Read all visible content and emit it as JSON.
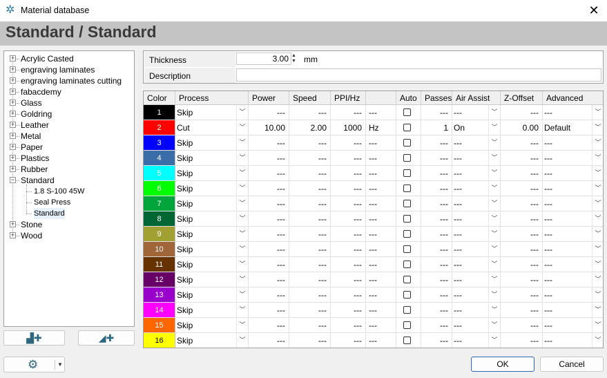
{
  "window": {
    "title": "Material database",
    "icon": "laser-tool-icon",
    "close_icon": "close-icon"
  },
  "heading": "Standard / Standard",
  "tree": {
    "items": [
      {
        "label": "Acrylic Casted",
        "expander": "+"
      },
      {
        "label": "engraving laminates",
        "expander": "+"
      },
      {
        "label": "engraving laminates cutting",
        "expander": "+"
      },
      {
        "label": "fabacdemy",
        "expander": "+"
      },
      {
        "label": "Glass",
        "expander": "+"
      },
      {
        "label": "Goldring",
        "expander": "+"
      },
      {
        "label": "Leather",
        "expander": "+"
      },
      {
        "label": "Metal",
        "expander": "+"
      },
      {
        "label": "Paper",
        "expander": "+"
      },
      {
        "label": "Plastics",
        "expander": "+"
      },
      {
        "label": "Rubber",
        "expander": "+"
      },
      {
        "label": "Standard",
        "expander": "−"
      },
      {
        "label": "1.8 S-100 45W",
        "child": true
      },
      {
        "label": "Seal Press",
        "child": true
      },
      {
        "label": "Standard",
        "child": true,
        "selected": true
      },
      {
        "label": "Stone",
        "expander": "+"
      },
      {
        "label": "Wood",
        "expander": "+"
      }
    ],
    "add_material_icon": "add-material-icon",
    "add_setting_icon": "add-setting-icon"
  },
  "properties": {
    "thickness_label": "Thickness",
    "thickness_value": "3.00",
    "thickness_unit": "mm",
    "description_label": "Description",
    "description_value": ""
  },
  "grid": {
    "headers": [
      "Color",
      "Process",
      "Power",
      "Speed",
      "PPI/Hz",
      "",
      "Auto",
      "Passes",
      "Air Assist",
      "Z-Offset",
      "Advanced"
    ],
    "rows": [
      {
        "num": "1",
        "color": "#000000",
        "text": "#ffffff",
        "process": "Skip",
        "power": "---",
        "speed": "---",
        "ppi": "---",
        "unit": "---",
        "passes": "---",
        "air": "---",
        "z": "---",
        "adv": "---"
      },
      {
        "num": "2",
        "color": "#ff0000",
        "text": "#ffffff",
        "process": "Cut",
        "power": "10.00",
        "speed": "2.00",
        "ppi": "1000",
        "unit": "Hz",
        "passes": "1",
        "air": "On",
        "z": "0.00",
        "adv": "Default"
      },
      {
        "num": "3",
        "color": "#0000ff",
        "text": "#ffffff",
        "process": "Skip",
        "power": "---",
        "speed": "---",
        "ppi": "---",
        "unit": "---",
        "passes": "---",
        "air": "---",
        "z": "---",
        "adv": "---"
      },
      {
        "num": "4",
        "color": "#3b6da8",
        "text": "#ffffff",
        "process": "Skip",
        "power": "---",
        "speed": "---",
        "ppi": "---",
        "unit": "---",
        "passes": "---",
        "air": "---",
        "z": "---",
        "adv": "---"
      },
      {
        "num": "5",
        "color": "#00ffff",
        "text": "#ffffff",
        "process": "Skip",
        "power": "---",
        "speed": "---",
        "ppi": "---",
        "unit": "---",
        "passes": "---",
        "air": "---",
        "z": "---",
        "adv": "---"
      },
      {
        "num": "6",
        "color": "#00ff00",
        "text": "#ffffff",
        "process": "Skip",
        "power": "---",
        "speed": "---",
        "ppi": "---",
        "unit": "---",
        "passes": "---",
        "air": "---",
        "z": "---",
        "adv": "---"
      },
      {
        "num": "7",
        "color": "#00a53c",
        "text": "#ffffff",
        "process": "Skip",
        "power": "---",
        "speed": "---",
        "ppi": "---",
        "unit": "---",
        "passes": "---",
        "air": "---",
        "z": "---",
        "adv": "---"
      },
      {
        "num": "8",
        "color": "#006633",
        "text": "#ffffff",
        "process": "Skip",
        "power": "---",
        "speed": "---",
        "ppi": "---",
        "unit": "---",
        "passes": "---",
        "air": "---",
        "z": "---",
        "adv": "---"
      },
      {
        "num": "9",
        "color": "#a0a033",
        "text": "#ffffff",
        "process": "Skip",
        "power": "---",
        "speed": "---",
        "ppi": "---",
        "unit": "---",
        "passes": "---",
        "air": "---",
        "z": "---",
        "adv": "---"
      },
      {
        "num": "10",
        "color": "#a0663a",
        "text": "#ffffff",
        "process": "Skip",
        "power": "---",
        "speed": "---",
        "ppi": "---",
        "unit": "---",
        "passes": "---",
        "air": "---",
        "z": "---",
        "adv": "---"
      },
      {
        "num": "11",
        "color": "#663300",
        "text": "#ffffff",
        "process": "Skip",
        "power": "---",
        "speed": "---",
        "ppi": "---",
        "unit": "---",
        "passes": "---",
        "air": "---",
        "z": "---",
        "adv": "---"
      },
      {
        "num": "12",
        "color": "#660066",
        "text": "#ffffff",
        "process": "Skip",
        "power": "---",
        "speed": "---",
        "ppi": "---",
        "unit": "---",
        "passes": "---",
        "air": "---",
        "z": "---",
        "adv": "---"
      },
      {
        "num": "13",
        "color": "#9900cc",
        "text": "#ffffff",
        "process": "Skip",
        "power": "---",
        "speed": "---",
        "ppi": "---",
        "unit": "---",
        "passes": "---",
        "air": "---",
        "z": "---",
        "adv": "---"
      },
      {
        "num": "14",
        "color": "#ff00ff",
        "text": "#ffffff",
        "process": "Skip",
        "power": "---",
        "speed": "---",
        "ppi": "---",
        "unit": "---",
        "passes": "---",
        "air": "---",
        "z": "---",
        "adv": "---"
      },
      {
        "num": "15",
        "color": "#ff6600",
        "text": "#ffffff",
        "process": "Skip",
        "power": "---",
        "speed": "---",
        "ppi": "---",
        "unit": "---",
        "passes": "---",
        "air": "---",
        "z": "---",
        "adv": "---"
      },
      {
        "num": "16",
        "color": "#ffff00",
        "text": "#000000",
        "process": "Skip",
        "power": "---",
        "speed": "---",
        "ppi": "---",
        "unit": "---",
        "passes": "---",
        "air": "---",
        "z": "---",
        "adv": "---"
      }
    ]
  },
  "buttons": {
    "ok": "OK",
    "cancel": "Cancel",
    "settings_icon": "gear-icon"
  }
}
